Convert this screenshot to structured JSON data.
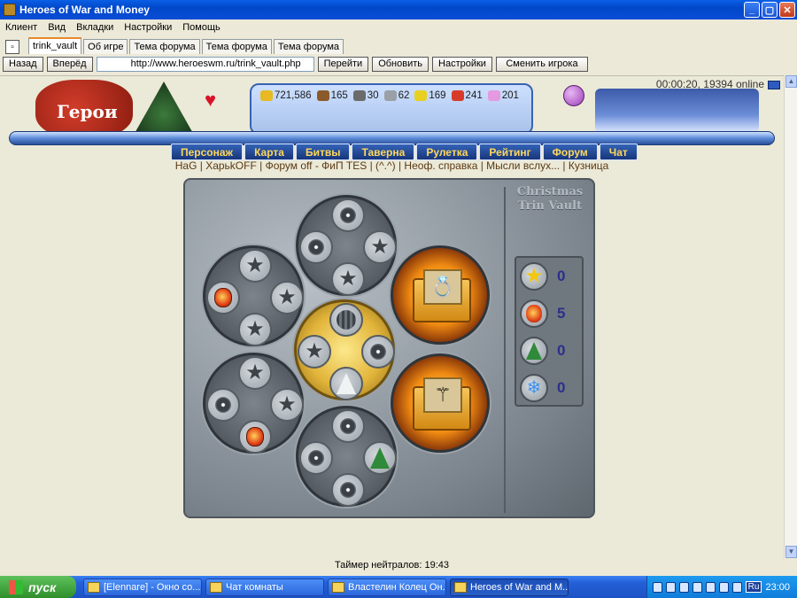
{
  "window": {
    "title": "Heroes of War and Money"
  },
  "menubar": [
    "Клиент",
    "Вид",
    "Вкладки",
    "Настройки",
    "Помощь"
  ],
  "tabs": [
    "trink_vault",
    "Об игре",
    "Тема форума",
    "Тема форума",
    "Тема форума"
  ],
  "nav": {
    "back": "Назад",
    "forward": "Вперёд",
    "url": "http://www.heroeswm.ru/trink_vault.php",
    "go": "Перейти",
    "refresh": "Обновить",
    "settings": "Настройки",
    "switch_player": "Сменить игрока"
  },
  "header": {
    "logo_text": "Герои",
    "timer_online": "00:00:20, 19394 online",
    "resources": [
      {
        "name": "gold",
        "value": "721,586",
        "color": "#e8b922"
      },
      {
        "name": "wood",
        "value": "165",
        "color": "#8a5a2a"
      },
      {
        "name": "ore",
        "value": "30",
        "color": "#6b6b6b"
      },
      {
        "name": "mercury",
        "value": "62",
        "color": "#9aa0a6"
      },
      {
        "name": "sulfur",
        "value": "169",
        "color": "#e8d020"
      },
      {
        "name": "crystals",
        "value": "241",
        "color": "#d83a2a"
      },
      {
        "name": "gems",
        "value": "201",
        "color": "#e59ae0"
      }
    ],
    "menu": [
      "Персонаж",
      "Карта",
      "Битвы",
      "Таверна",
      "Рулетка",
      "Рейтинг",
      "Форум",
      "Чат"
    ],
    "links": "HaG | ХарьkOFF | Форум off - ФиП TES | (^.^) | Неоф. справка | Мысли вслух... | Кузница"
  },
  "vault": {
    "title": "Christmas Trin Vault",
    "counters": [
      {
        "icon": "gold-star-icon",
        "value": "0"
      },
      {
        "icon": "lantern-icon",
        "value": "5"
      },
      {
        "icon": "tree-icon",
        "value": "0"
      },
      {
        "icon": "snowflake-icon",
        "value": "0"
      }
    ],
    "prizes": [
      "ring-icon",
      "staff-icon"
    ]
  },
  "footer": {
    "neutral_timer": "Таймер нейтралов: 19:43"
  },
  "taskbar": {
    "start": "пуск",
    "tasks": [
      "[Elennare] - Окно со...",
      "Чат комнаты",
      "Властелин Колец Он...",
      "Heroes of War and M..."
    ],
    "lang": "Ru",
    "clock": "23:00"
  }
}
